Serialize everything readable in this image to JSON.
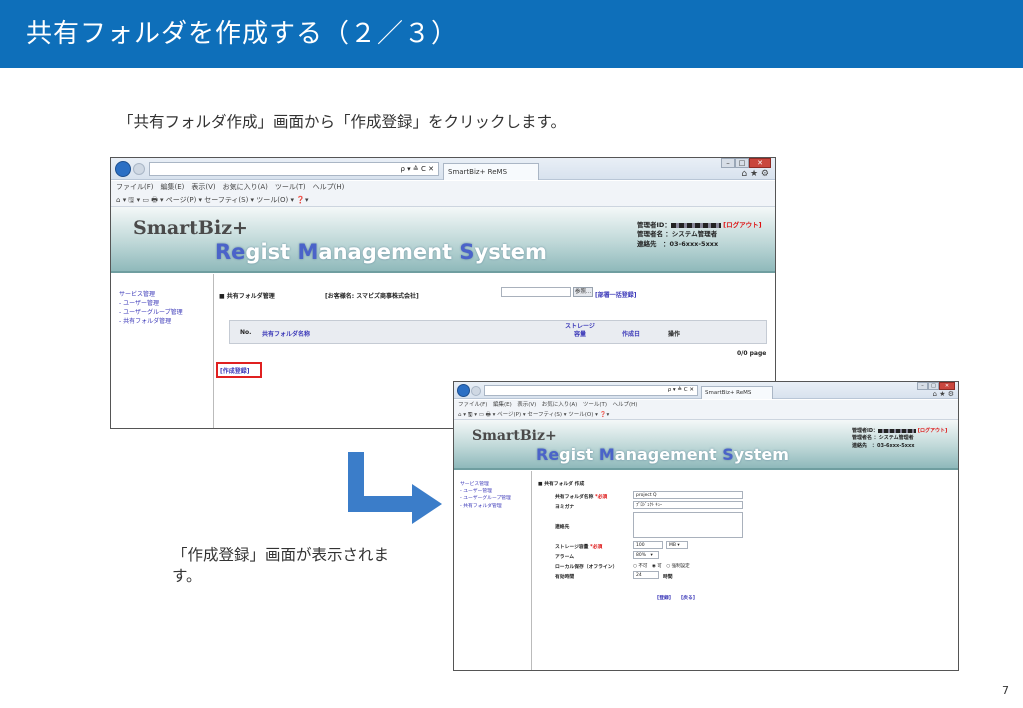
{
  "slide": {
    "title": "共有フォルダを作成する（２／３）",
    "intro": "「共有フォルダ作成」画面から「作成登録」をクリックします。",
    "caption": "「作成登録」画面が表示されます。",
    "page_number": "7"
  },
  "browser1": {
    "address": "ρ ▾ ≙ C ✕",
    "tab_title": "SmartBiz+ ReMS",
    "menu": "ファイル(F)　編集(E)　表示(V)　お気に入り(A)　ツール(T)　ヘルプ(H)",
    "commands": "▾ 🖫 ▾ ▭ 🖶 ▾ ページ(P) ▾ セーフティ(S) ▾ ツール(O) ▾",
    "logo_top": "SmartBiz+",
    "logo_main": {
      "re": "Re",
      "gist": "gist ",
      "m": "M",
      "anagement": "anagement ",
      "s": "S",
      "ystem": "ystem"
    },
    "user": {
      "id_label": "管理者ID：",
      "logout": "[ログアウト]",
      "name_line": "管理者名 ：システム管理者",
      "contact_line": "連絡先　：03-6xxx-5xxx"
    },
    "sidebar": [
      "サービス管理",
      "- ユーザー管理",
      "- ユーザーグループ管理",
      "- 共有フォルダ管理"
    ],
    "content": {
      "heading": "■ 共有フォルダ管理",
      "customer": "[お客様名: スマビズ商事株式会社]",
      "search_btn": "参照...",
      "bulk_link": "[部署一括登録]",
      "columns": [
        "No.",
        "共有フォルダ名称",
        "ストレージ\n容量",
        "作成日",
        "操作"
      ],
      "page_info": "0/0 page",
      "create_link": "[作成登録]"
    }
  },
  "browser2": {
    "address": "ρ ▾ ≙ C ✕",
    "tab_title": "SmartBiz+ ReMS",
    "menu": "ファイル(F)　編集(E)　表示(V)　お気に入り(A)　ツール(T)　ヘルプ(H)",
    "commands": "▾ 🖫 ▾ ▭ 🖶 ▾ ページ(P) ▾ セーフティ(S) ▾ ツール(O) ▾",
    "logo_top": "SmartBiz+",
    "user": {
      "id_label": "管理者ID：",
      "logout": "[ログアウト]",
      "name_line": "管理者名 ：システム管理者",
      "contact_line": "連絡先　：03-6xxx-5xxx"
    },
    "sidebar": [
      "サービス管理",
      "- ユーザー管理",
      "- ユーザーグループ管理",
      "- 共有フォルダ管理"
    ],
    "form": {
      "heading": "■ 共有フォルダ 作成",
      "name_label": "共有フォルダ名称",
      "required": "*必須",
      "name_value": "project Q",
      "kana_label": "ヨミガナ",
      "kana_value": "ﾌﾟﾛｼﾞｪｸﾄ ｷｭｰ",
      "note_label": "連絡先",
      "storage_label": "ストレージ容量",
      "storage_value": "100",
      "storage_unit": "MB ▾",
      "alarm_label": "アラーム",
      "alarm_value": "80%　▾",
      "local_label": "ローカル保存（オフライン）",
      "local_options": "○ 不可　◉ 可　○ 強制設定",
      "keep_label": "有効時間",
      "keep_value": "24",
      "keep_unit": "時間",
      "register_btn": "[登録]",
      "back_btn": "[戻る]"
    }
  }
}
